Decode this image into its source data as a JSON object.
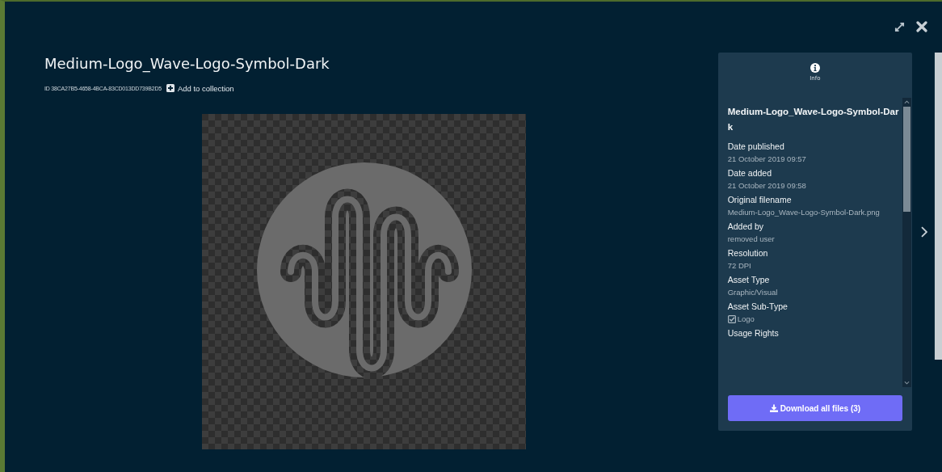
{
  "asset": {
    "title": "Medium-Logo_Wave-Logo-Symbol-Dark",
    "id": "ID 38CA27B5-4658-4BCA-83CD013DD739B2D5",
    "add_label": "Add to collection"
  },
  "panel": {
    "tab_label": "Info",
    "heading": "Medium-Logo_Wave-Logo-Symbol-Dar k",
    "fields": [
      {
        "kind": "text",
        "label": "Date published",
        "value": "21 October 2019 09:57"
      },
      {
        "kind": "text",
        "label": "Date added",
        "value": "21 October 2019 09:58"
      },
      {
        "kind": "text",
        "label": "Original filename",
        "value": "Medium-Logo_Wave-Logo-Symbol-Dark.png"
      },
      {
        "kind": "text",
        "label": "Added by",
        "value": "removed user"
      },
      {
        "kind": "text",
        "label": "Resolution",
        "value": "72 DPI"
      },
      {
        "kind": "text",
        "label": "Asset Type",
        "value": "Graphic/Visual"
      },
      {
        "kind": "check",
        "label": "Asset Sub-Type",
        "value": "Logo",
        "checked": true
      },
      {
        "kind": "label",
        "label": "Usage Rights"
      }
    ],
    "download_label": "Download all files (3)"
  }
}
